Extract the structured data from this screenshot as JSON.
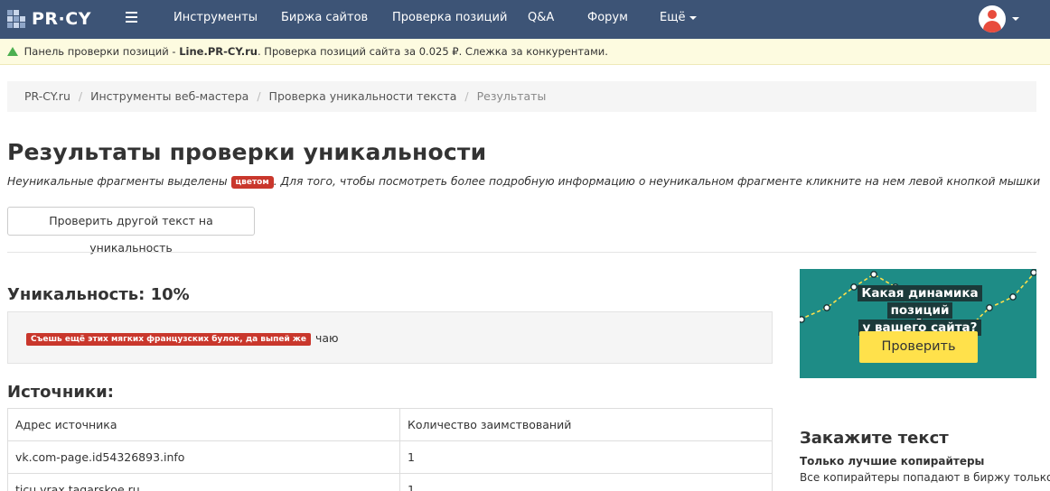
{
  "nav": {
    "logo_text": "PR·CY",
    "items": [
      "Инструменты",
      "Биржа сайтов",
      "Проверка позиций",
      "Q&A",
      "Форум",
      "Ещё"
    ]
  },
  "promo": {
    "lead": " Панель проверки позиций - ",
    "link": "Line.PR-CY.ru",
    "rest": ". Проверка позиций сайта за 0.025 ₽. Слежка за конкурентами."
  },
  "breadcrumb": {
    "items": [
      "PR-CY.ru",
      "Инструменты веб-мастера",
      "Проверка уникальности текста"
    ],
    "current": "Результаты"
  },
  "page": {
    "title": "Результаты проверки уникальности",
    "note_before": "Неуникальные фрагменты выделены ",
    "note_tag": "цветом",
    "note_after": ". Для того, чтобы посмотреть более подробную информацию о неуникальном фрагменте кликните на нем левой кнопкой мышки",
    "check_button": "Проверить другой текст на уникальность"
  },
  "uniqueness": {
    "heading": "Уникальность: 10%",
    "fragment": "Съешь ещё этих мягких французских булок, да выпей же",
    "plain": "чаю"
  },
  "sources": {
    "heading": "Источники:",
    "columns": [
      "Адрес источника",
      "Количество заимствований"
    ],
    "rows": [
      [
        "vk.com-page.id54326893.info",
        "1"
      ],
      [
        "ticu.vrax.tagarskoe.ru",
        "1"
      ]
    ]
  },
  "ad": {
    "line1": "Какая динамика позиций",
    "line2": "у вашего сайта?",
    "button": "Проверить"
  },
  "order": {
    "heading": "Закажите текст",
    "subheading": "Только лучшие копирайтеры",
    "text": "Все копирайтеры попадают в биржу только"
  },
  "colors": {
    "nav_bg": "#3d5476",
    "highlight": "#c9372c",
    "ad_bg": "#1e8c86",
    "ad_button": "#ffe14b"
  }
}
